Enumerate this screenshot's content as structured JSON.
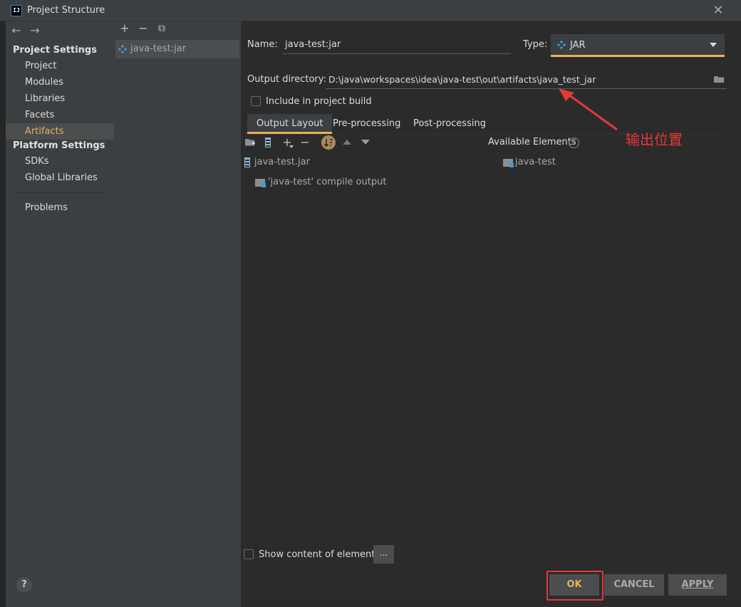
{
  "window": {
    "app_icon": "IJ",
    "title": "Project Structure",
    "close_label": "✕"
  },
  "sidebar": {
    "back_label": "←",
    "forward_label": "→",
    "sections": [
      {
        "title": "Project Settings",
        "items": [
          "Project",
          "Modules",
          "Libraries",
          "Facets",
          "Artifacts"
        ]
      },
      {
        "title": "Platform Settings",
        "items": [
          "SDKs",
          "Global Libraries"
        ]
      }
    ],
    "selected_item": "Artifacts",
    "problems_label": "Problems"
  },
  "artifact_list": {
    "add_label": "+",
    "remove_label": "−",
    "copy_label": "⧉",
    "items": [
      "java-test:jar"
    ]
  },
  "artifact_form": {
    "name_label": "Name:",
    "name_value": "java-test:jar",
    "type_label": "Type:",
    "type_value": "JAR",
    "output_dir_label": "Output directory:",
    "output_dir_value": "D:\\java\\workspaces\\idea\\java-test\\out\\artifacts\\java_test_jar",
    "include_build_label": "Include in project build",
    "include_build_checked": false
  },
  "tabs": [
    "Output Layout",
    "Pre-processing",
    "Post-processing"
  ],
  "active_tab": "Output Layout",
  "layout_toolbar": {
    "add_label": "+",
    "remove_label": "−"
  },
  "output_tree": {
    "root": "java-test.jar",
    "children": [
      "'java-test' compile output"
    ]
  },
  "available_elements": {
    "title": "Available Elements",
    "help_label": "?",
    "items": [
      "java-test"
    ]
  },
  "show_content_label": "Show content of elements",
  "show_content_checked": false,
  "browse_label": "...",
  "buttons": {
    "help": "?",
    "ok": "OK",
    "cancel": "CANCEL",
    "apply": "APPLY"
  },
  "annotation": {
    "text": "输出位置",
    "color": "#e53935"
  },
  "colors": {
    "accent": "#e8b15a",
    "background": "#2b2b2b",
    "panel": "#3c3f41",
    "jar_icon": "#3aa0d8"
  }
}
